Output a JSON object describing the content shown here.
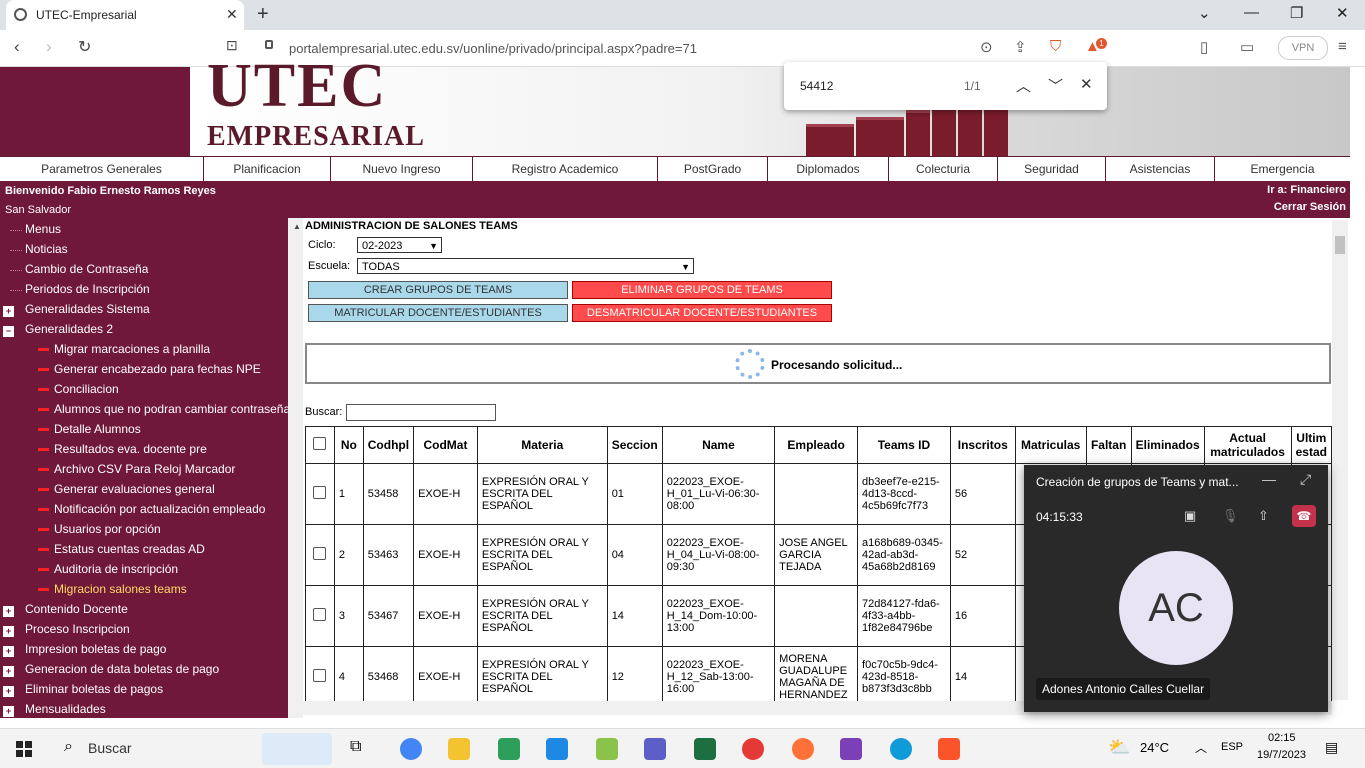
{
  "browser": {
    "tab_title": "UTEC-Empresarial",
    "url": "portalempresarial.utec.edu.sv/uonline/privado/principal.aspx?padre=71",
    "vpn_label": "VPN",
    "alert_count": "1",
    "find": {
      "query": "54412",
      "count": "1/1"
    }
  },
  "banner": {
    "logo_main": "UTEC",
    "logo_sub": "EMPRESARIAL"
  },
  "menu": [
    "Parametros Generales",
    "Planificacion",
    "Nuevo Ingreso",
    "Registro Academico",
    "PostGrado",
    "Diplomados",
    "Colecturia",
    "Seguridad",
    "Asistencias",
    "Emergencia"
  ],
  "welcome": {
    "user": "Bienvenido Fabio Ernesto Ramos Reyes",
    "campus": "San Salvador",
    "goto": "Ir a: Financiero",
    "logout": "Cerrar Sesión"
  },
  "sidebar": {
    "items": [
      {
        "label": "Menus",
        "type": "top"
      },
      {
        "label": "Noticias",
        "type": "top"
      },
      {
        "label": "Cambio de Contraseña",
        "type": "top"
      },
      {
        "label": "Periodos de Inscripción",
        "type": "top"
      },
      {
        "label": "Generalidades Sistema",
        "type": "plus"
      },
      {
        "label": "Generalidades 2",
        "type": "minus"
      },
      {
        "label": "Migrar marcaciones a planilla",
        "type": "sub"
      },
      {
        "label": "Generar encabezado para fechas NPE",
        "type": "sub"
      },
      {
        "label": "Conciliacion",
        "type": "sub"
      },
      {
        "label": "Alumnos que no podran cambiar contraseña",
        "type": "sub"
      },
      {
        "label": "Detalle Alumnos",
        "type": "sub"
      },
      {
        "label": "Resultados eva. docente pre",
        "type": "sub"
      },
      {
        "label": "Archivo CSV Para Reloj Marcador",
        "type": "sub"
      },
      {
        "label": "Generar evaluaciones general",
        "type": "sub"
      },
      {
        "label": "Notificación por actualización empleado",
        "type": "sub"
      },
      {
        "label": "Usuarios por opción",
        "type": "sub"
      },
      {
        "label": "Estatus cuentas creadas AD",
        "type": "sub"
      },
      {
        "label": "Auditoria de inscripción",
        "type": "sub"
      },
      {
        "label": "Migracion salones teams",
        "type": "active"
      },
      {
        "label": "Contenido Docente",
        "type": "plus"
      },
      {
        "label": "Proceso Inscripcion",
        "type": "plus"
      },
      {
        "label": "Impresion boletas de pago",
        "type": "plus"
      },
      {
        "label": "Generacion de data boletas de pago",
        "type": "plus"
      },
      {
        "label": "Eliminar boletas de pagos",
        "type": "plus"
      },
      {
        "label": "Mensualidades",
        "type": "plus"
      }
    ]
  },
  "page": {
    "title": "ADMINISTRACION DE SALONES TEAMS",
    "ciclo_label": "Ciclo:",
    "ciclo_value": "02-2023",
    "escuela_label": "Escuela:",
    "escuela_value": "TODAS",
    "btn_crear": "CREAR GRUPOS DE TEAMS",
    "btn_eliminar": "ELIMINAR GRUPOS DE TEAMS",
    "btn_matricular": "MATRICULAR DOCENTE/ESTUDIANTES",
    "btn_desmatricular": "DESMATRICULAR DOCENTE/ESTUDIANTES",
    "processing": "Procesando solicitud...",
    "search_label": "Buscar:",
    "search_value": ""
  },
  "table": {
    "headers": [
      "",
      "No",
      "Codhpl",
      "CodMat",
      "Materia",
      "Seccion",
      "Name",
      "Empleado",
      "Teams ID",
      "Inscritos",
      "Matriculas",
      "Faltan",
      "Eliminados",
      "Actual matriculados",
      "Ultim estad"
    ],
    "rows": [
      {
        "no": "1",
        "codhpl": "53458",
        "codmat": "EXOE-H",
        "materia": "EXPRESIÓN ORAL Y ESCRITA DEL ESPAÑOL",
        "seccion": "01",
        "name": "022023_EXOE-H_01_Lu-Vi-06:30-08:00",
        "empleado": "",
        "teams_id": "db3eef7e-e215-4d13-8ccd-4c5b69fc7f73",
        "inscritos": "56"
      },
      {
        "no": "2",
        "codhpl": "53463",
        "codmat": "EXOE-H",
        "materia": "EXPRESIÓN ORAL Y ESCRITA DEL ESPAÑOL",
        "seccion": "04",
        "name": "022023_EXOE-H_04_Lu-Vi-08:00-09:30",
        "empleado": "JOSE ANGEL GARCIA TEJADA",
        "teams_id": "a168b689-0345-42ad-ab3d-45a68b2d8169",
        "inscritos": "52"
      },
      {
        "no": "3",
        "codhpl": "53467",
        "codmat": "EXOE-H",
        "materia": "EXPRESIÓN ORAL Y ESCRITA DEL ESPAÑOL",
        "seccion": "14",
        "name": "022023_EXOE-H_14_Dom-10:00-13:00",
        "empleado": "",
        "teams_id": "72d84127-fda6-4f33-a4bb-1f82e84796be",
        "inscritos": "16"
      },
      {
        "no": "4",
        "codhpl": "53468",
        "codmat": "EXOE-H",
        "materia": "EXPRESIÓN ORAL Y ESCRITA DEL ESPAÑOL",
        "seccion": "12",
        "name": "022023_EXOE-H_12_Sab-13:00-16:00",
        "empleado": "MORENA GUADALUPE MAGAÑA DE HERNANDEZ",
        "teams_id": "f0c70c5b-9dc4-423d-8518-b873f3d3c8bb",
        "inscritos": "14"
      }
    ]
  },
  "teams_popup": {
    "title": "Creación de grupos de Teams y mat...",
    "timer": "04:15:33",
    "avatar": "AC",
    "participant": "Adones Antonio Calles Cuellar"
  },
  "taskbar": {
    "search": "Buscar",
    "temp": "24°C",
    "lang": "ESP",
    "time": "02:15",
    "date": "19/7/2023"
  }
}
